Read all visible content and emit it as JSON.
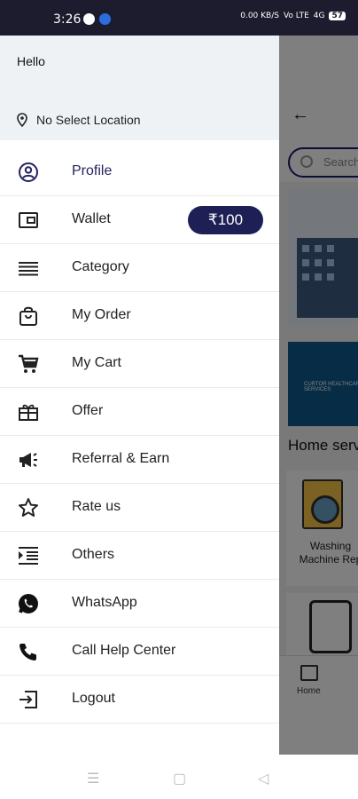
{
  "status_bar": {
    "time": "3:26",
    "right_labels": [
      "0.00 KB/S",
      "Vo LTE",
      "4G"
    ],
    "battery": "57"
  },
  "drawer": {
    "greeting": "Hello",
    "location": "No Select Location",
    "items": [
      {
        "label": "Profile",
        "icon": "profile-icon",
        "active": true
      },
      {
        "label": "Wallet",
        "icon": "wallet-icon",
        "badge": "₹100"
      },
      {
        "label": "Category",
        "icon": "menu-lines-icon"
      },
      {
        "label": "My Order",
        "icon": "shopping-bag-icon"
      },
      {
        "label": "My Cart",
        "icon": "cart-icon"
      },
      {
        "label": "Offer",
        "icon": "gift-icon"
      },
      {
        "label": "Referral & Earn",
        "icon": "megaphone-icon"
      },
      {
        "label": "Rate us",
        "icon": "star-icon"
      },
      {
        "label": "Others",
        "icon": "indent-icon"
      },
      {
        "label": "WhatsApp",
        "icon": "whatsapp-icon"
      },
      {
        "label": "Call Help Center",
        "icon": "phone-icon"
      },
      {
        "label": "Logout",
        "icon": "logout-icon"
      }
    ]
  },
  "background": {
    "search_placeholder": "Search",
    "banner_text": "CURTOR HEALTHCARE SERVICES",
    "section_title": "Home serv",
    "card1_label_line1": "Washing",
    "card1_label_line2": "Machine Rep",
    "nav_home": "Home"
  },
  "colors": {
    "accent": "#1e1f55",
    "status_bar": "#1c1c2e",
    "drawer_header": "#eff2f4"
  }
}
